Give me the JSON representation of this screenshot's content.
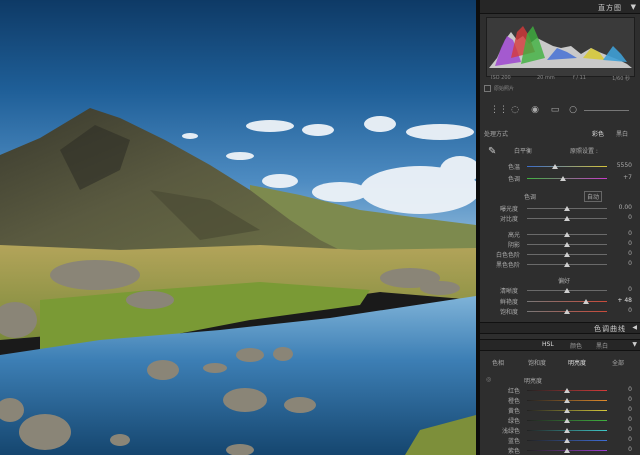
{
  "panel_header": {
    "title": "直方图",
    "arrow": "▼"
  },
  "histogram": {
    "meta": [
      "ISO 200",
      "20 mm",
      "f / 11",
      "1/60 秒"
    ],
    "original_photo_label": "原始照片"
  },
  "basic": {
    "treatment_label": "处理方式",
    "treatment_options": [
      "彩色",
      "黑白"
    ],
    "wb_label": "白平衡",
    "wb_value": "原照设置 :",
    "temp_label": "色温",
    "temp_value": "5550",
    "tint_label": "色调",
    "tint_value": "+7",
    "tone_label": "色调",
    "auto_label": "自动",
    "exposure_label": "曝光度",
    "exposure_value": "0.00",
    "contrast_label": "对比度",
    "contrast_value": "0",
    "highlights_label": "高光",
    "highlights_value": "0",
    "shadows_label": "阴影",
    "shadows_value": "0",
    "whites_label": "白色色阶",
    "whites_value": "0",
    "blacks_label": "黑色色阶",
    "blacks_value": "0",
    "presence_label": "偏好",
    "clarity_label": "清晰度",
    "clarity_value": "0",
    "vibrance_label": "鲜艳度",
    "vibrance_value": "+ 48",
    "saturation_label": "饱和度",
    "saturation_value": "0"
  },
  "tone_curve_bar": {
    "title": "色调曲线",
    "arrow": "◀"
  },
  "hsl_bar": {
    "tabs": [
      "HSL",
      "颜色",
      "黑白"
    ],
    "arrow": "▼"
  },
  "hsl": {
    "subtabs": [
      "色相",
      "饱和度",
      "明亮度",
      "全部"
    ],
    "active_subtab": "明亮度",
    "group_label": "明亮度",
    "sliders": [
      {
        "label": "红色",
        "value": "0"
      },
      {
        "label": "橙色",
        "value": "0"
      },
      {
        "label": "黄色",
        "value": "0"
      },
      {
        "label": "绿色",
        "value": "0"
      },
      {
        "label": "浅绿色",
        "value": "0"
      },
      {
        "label": "蓝色",
        "value": "0"
      },
      {
        "label": "紫色",
        "value": "0"
      }
    ]
  },
  "colors": {
    "panel_bg": "#2e2e2e",
    "header_bg": "#262626"
  }
}
